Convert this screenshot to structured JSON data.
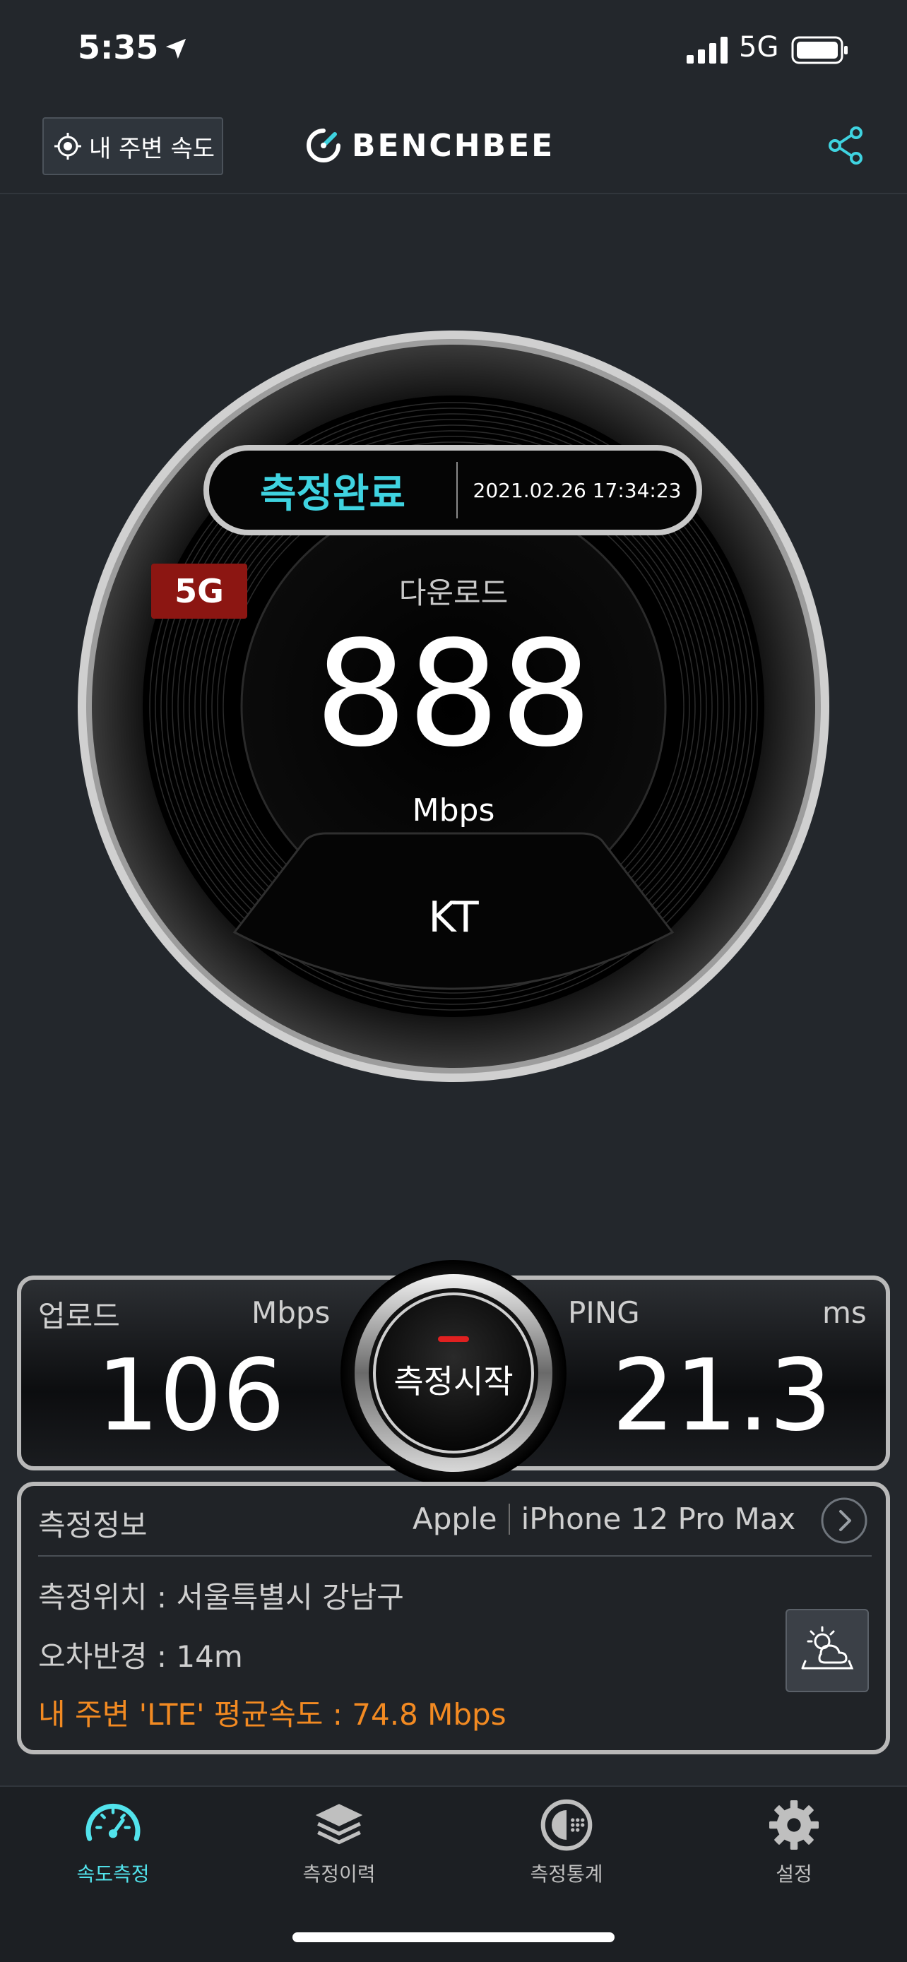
{
  "status_bar": {
    "time": "5:35",
    "network": "5G"
  },
  "header": {
    "nearby_button_label": "내 주변 속도",
    "logo_text": "BENCHBEE"
  },
  "gauge": {
    "status": "측정완료",
    "datetime": "2021.02.26 17:34:23",
    "network_badge": "5G",
    "download_label": "다운로드",
    "download_value": "888",
    "download_unit": "Mbps",
    "carrier": "KT"
  },
  "results": {
    "upload_label": "업로드",
    "upload_unit": "Mbps",
    "upload_value": "106",
    "ping_label": "PING",
    "ping_unit": "ms",
    "ping_value": "21.3",
    "start_button_label": "측정시작"
  },
  "info": {
    "title": "측정정보",
    "device_brand": "Apple",
    "device_model": "iPhone 12 Pro Max",
    "location": "측정위치 : 서울특별시 강남구",
    "error_radius": "오차반경 : 14m",
    "nearby_average": "내 주변 'LTE' 평균속도 : 74.8 Mbps"
  },
  "tabs": [
    {
      "label": "속도측정",
      "icon": "speedometer-icon",
      "active": true
    },
    {
      "label": "측정이력",
      "icon": "layers-icon",
      "active": false
    },
    {
      "label": "측정통계",
      "icon": "stats-dial-icon",
      "active": false
    },
    {
      "label": "설정",
      "icon": "gear-icon",
      "active": false
    }
  ],
  "colors": {
    "accent_cyan": "#3fd3e0",
    "badge_red": "#8c1612",
    "highlight_orange": "#f28a22",
    "background": "#23272c"
  }
}
